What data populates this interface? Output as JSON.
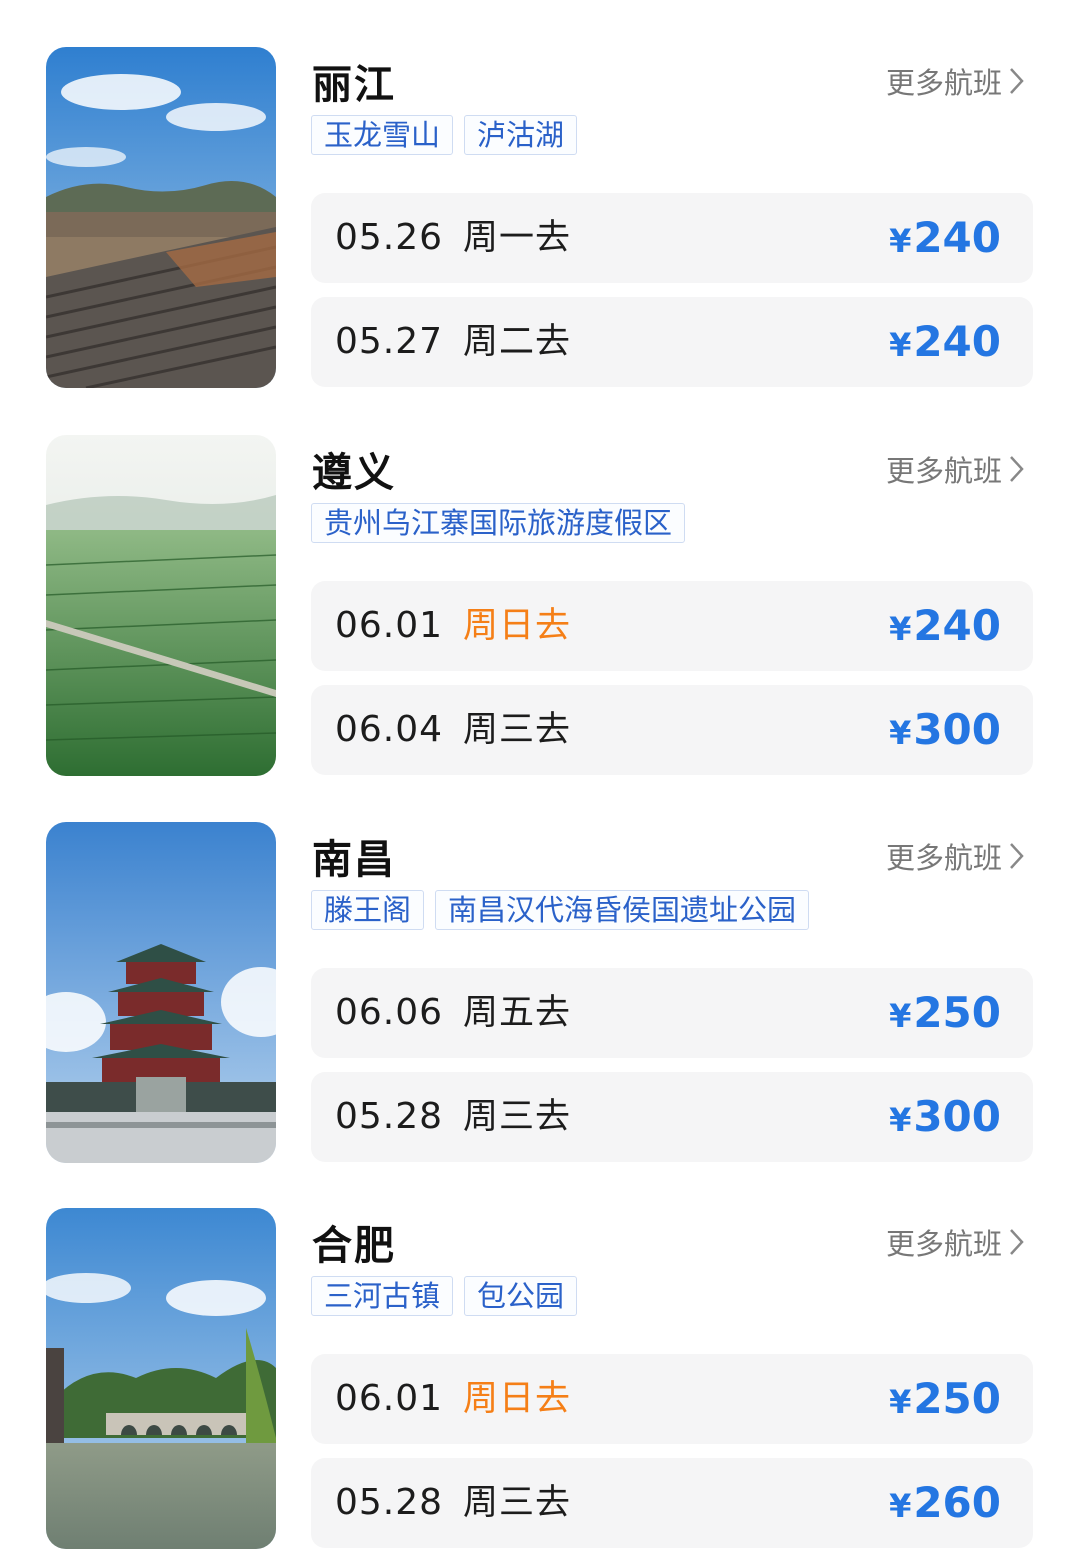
{
  "more_label": "更多航班",
  "colors": {
    "accent_blue": "#2476e2",
    "weekend_orange": "#f57f17",
    "tag_text": "#2a61c9"
  },
  "destinations": [
    {
      "city": "丽江",
      "tags": [
        "玉龙雪山",
        "泸沽湖"
      ],
      "flights": [
        {
          "date": "05.26",
          "day": "周一去",
          "currency": "¥",
          "price": "240",
          "weekend": false
        },
        {
          "date": "05.27",
          "day": "周二去",
          "currency": "¥",
          "price": "240",
          "weekend": false
        }
      ]
    },
    {
      "city": "遵义",
      "tags": [
        "贵州乌江寨国际旅游度假区"
      ],
      "flights": [
        {
          "date": "06.01",
          "day": "周日去",
          "currency": "¥",
          "price": "240",
          "weekend": true
        },
        {
          "date": "06.04",
          "day": "周三去",
          "currency": "¥",
          "price": "300",
          "weekend": false
        }
      ]
    },
    {
      "city": "南昌",
      "tags": [
        "滕王阁",
        "南昌汉代海昏侯国遗址公园"
      ],
      "flights": [
        {
          "date": "06.06",
          "day": "周五去",
          "currency": "¥",
          "price": "250",
          "weekend": false
        },
        {
          "date": "05.28",
          "day": "周三去",
          "currency": "¥",
          "price": "300",
          "weekend": false
        }
      ]
    },
    {
      "city": "合肥",
      "tags": [
        "三河古镇",
        "包公园"
      ],
      "flights": [
        {
          "date": "06.01",
          "day": "周日去",
          "currency": "¥",
          "price": "250",
          "weekend": true
        },
        {
          "date": "05.28",
          "day": "周三去",
          "currency": "¥",
          "price": "260",
          "weekend": false
        }
      ]
    }
  ]
}
